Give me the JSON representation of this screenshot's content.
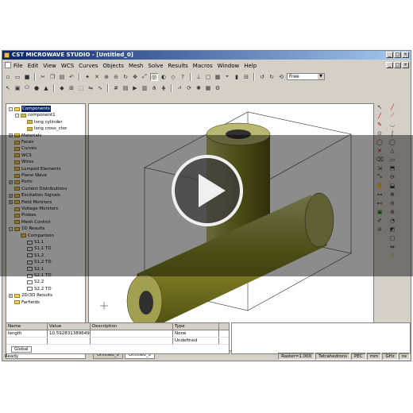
{
  "window": {
    "title": "CST MICROWAVE STUDIO - [Untitled_0]",
    "buttons": [
      "_",
      "□",
      "×"
    ]
  },
  "menu": [
    "File",
    "Edit",
    "View",
    "WCS",
    "Curves",
    "Objects",
    "Mesh",
    "Solve",
    "Results",
    "Macros",
    "Window",
    "Help"
  ],
  "toolbar": {
    "view_combo": "Free"
  },
  "tree": {
    "items": [
      {
        "label": "Components",
        "level": 0,
        "type": "folder",
        "expander": "-"
      },
      {
        "label": "component1",
        "level": 1,
        "type": "component",
        "expander": "-"
      },
      {
        "label": "long cylinder",
        "level": 2,
        "type": "solid",
        "expander": ""
      },
      {
        "label": "long cross_ctor",
        "level": 2,
        "type": "solid",
        "expander": ""
      },
      {
        "label": "Materials",
        "level": 0,
        "type": "folder",
        "expander": "+"
      },
      {
        "label": "Faces",
        "level": 0,
        "type": "folder",
        "expander": ""
      },
      {
        "label": "Curves",
        "level": 0,
        "type": "folder",
        "expander": ""
      },
      {
        "label": "WCS",
        "level": 0,
        "type": "folder",
        "expander": ""
      },
      {
        "label": "Wires",
        "level": 0,
        "type": "folder",
        "expander": ""
      },
      {
        "label": "Lumped Elements",
        "level": 0,
        "type": "folder",
        "expander": ""
      },
      {
        "label": "Plane Wave",
        "level": 0,
        "type": "folder",
        "expander": ""
      },
      {
        "label": "Ports",
        "level": 0,
        "type": "folder",
        "expander": "+"
      },
      {
        "label": "Current Distributions",
        "level": 0,
        "type": "folder",
        "expander": ""
      },
      {
        "label": "Excitation Signals",
        "level": 0,
        "type": "folder",
        "expander": "+"
      },
      {
        "label": "Field Monitors",
        "level": 0,
        "type": "folder",
        "expander": "+"
      },
      {
        "label": "Voltage Monitors",
        "level": 0,
        "type": "folder",
        "expander": ""
      },
      {
        "label": "Probes",
        "level": 0,
        "type": "folder",
        "expander": ""
      },
      {
        "label": "Mesh Control",
        "level": 0,
        "type": "folder",
        "expander": ""
      },
      {
        "label": "1D Results",
        "level": 0,
        "type": "folder",
        "expander": "-"
      },
      {
        "label": "Comparison",
        "level": 1,
        "type": "folder",
        "expander": ""
      },
      {
        "label": "S1,1",
        "level": 2,
        "type": "result",
        "expander": ""
      },
      {
        "label": "S1,1 TD",
        "level": 2,
        "type": "result",
        "expander": ""
      },
      {
        "label": "S1,2",
        "level": 2,
        "type": "result",
        "expander": ""
      },
      {
        "label": "S1,2 TD",
        "level": 2,
        "type": "result",
        "expander": ""
      },
      {
        "label": "S2,1",
        "level": 2,
        "type": "result",
        "expander": ""
      },
      {
        "label": "S2,1 TD",
        "level": 2,
        "type": "result",
        "expander": ""
      },
      {
        "label": "S2,2",
        "level": 2,
        "type": "result",
        "expander": ""
      },
      {
        "label": "S2,2 TD",
        "level": 2,
        "type": "result",
        "expander": ""
      },
      {
        "label": "2D/3D Results",
        "level": 0,
        "type": "folder",
        "expander": "+"
      },
      {
        "label": "Farfields",
        "level": 0,
        "type": "folder",
        "expander": ""
      }
    ]
  },
  "view_tabs": [
    "Untitled_0",
    "Untitled_0"
  ],
  "parameters": {
    "headers": [
      "Name",
      "Value",
      "Description",
      "Type"
    ],
    "rows": [
      [
        "length",
        "10.592831389649",
        "",
        "None"
      ],
      [
        "",
        "",
        "",
        "Undefined"
      ]
    ],
    "tab": "Global"
  },
  "status": {
    "ready": "Ready",
    "raster": "Raster=1.000",
    "solver": "Tetrahedrons",
    "bc": "PEC",
    "u1": "mm",
    "u2": "GHz",
    "u3": "ns"
  },
  "colors": {
    "titlebar_start": "#0a246a",
    "titlebar_end": "#a6caf0",
    "cylinder": "#8a8a28"
  },
  "overlay": {
    "icon": "play-icon"
  }
}
